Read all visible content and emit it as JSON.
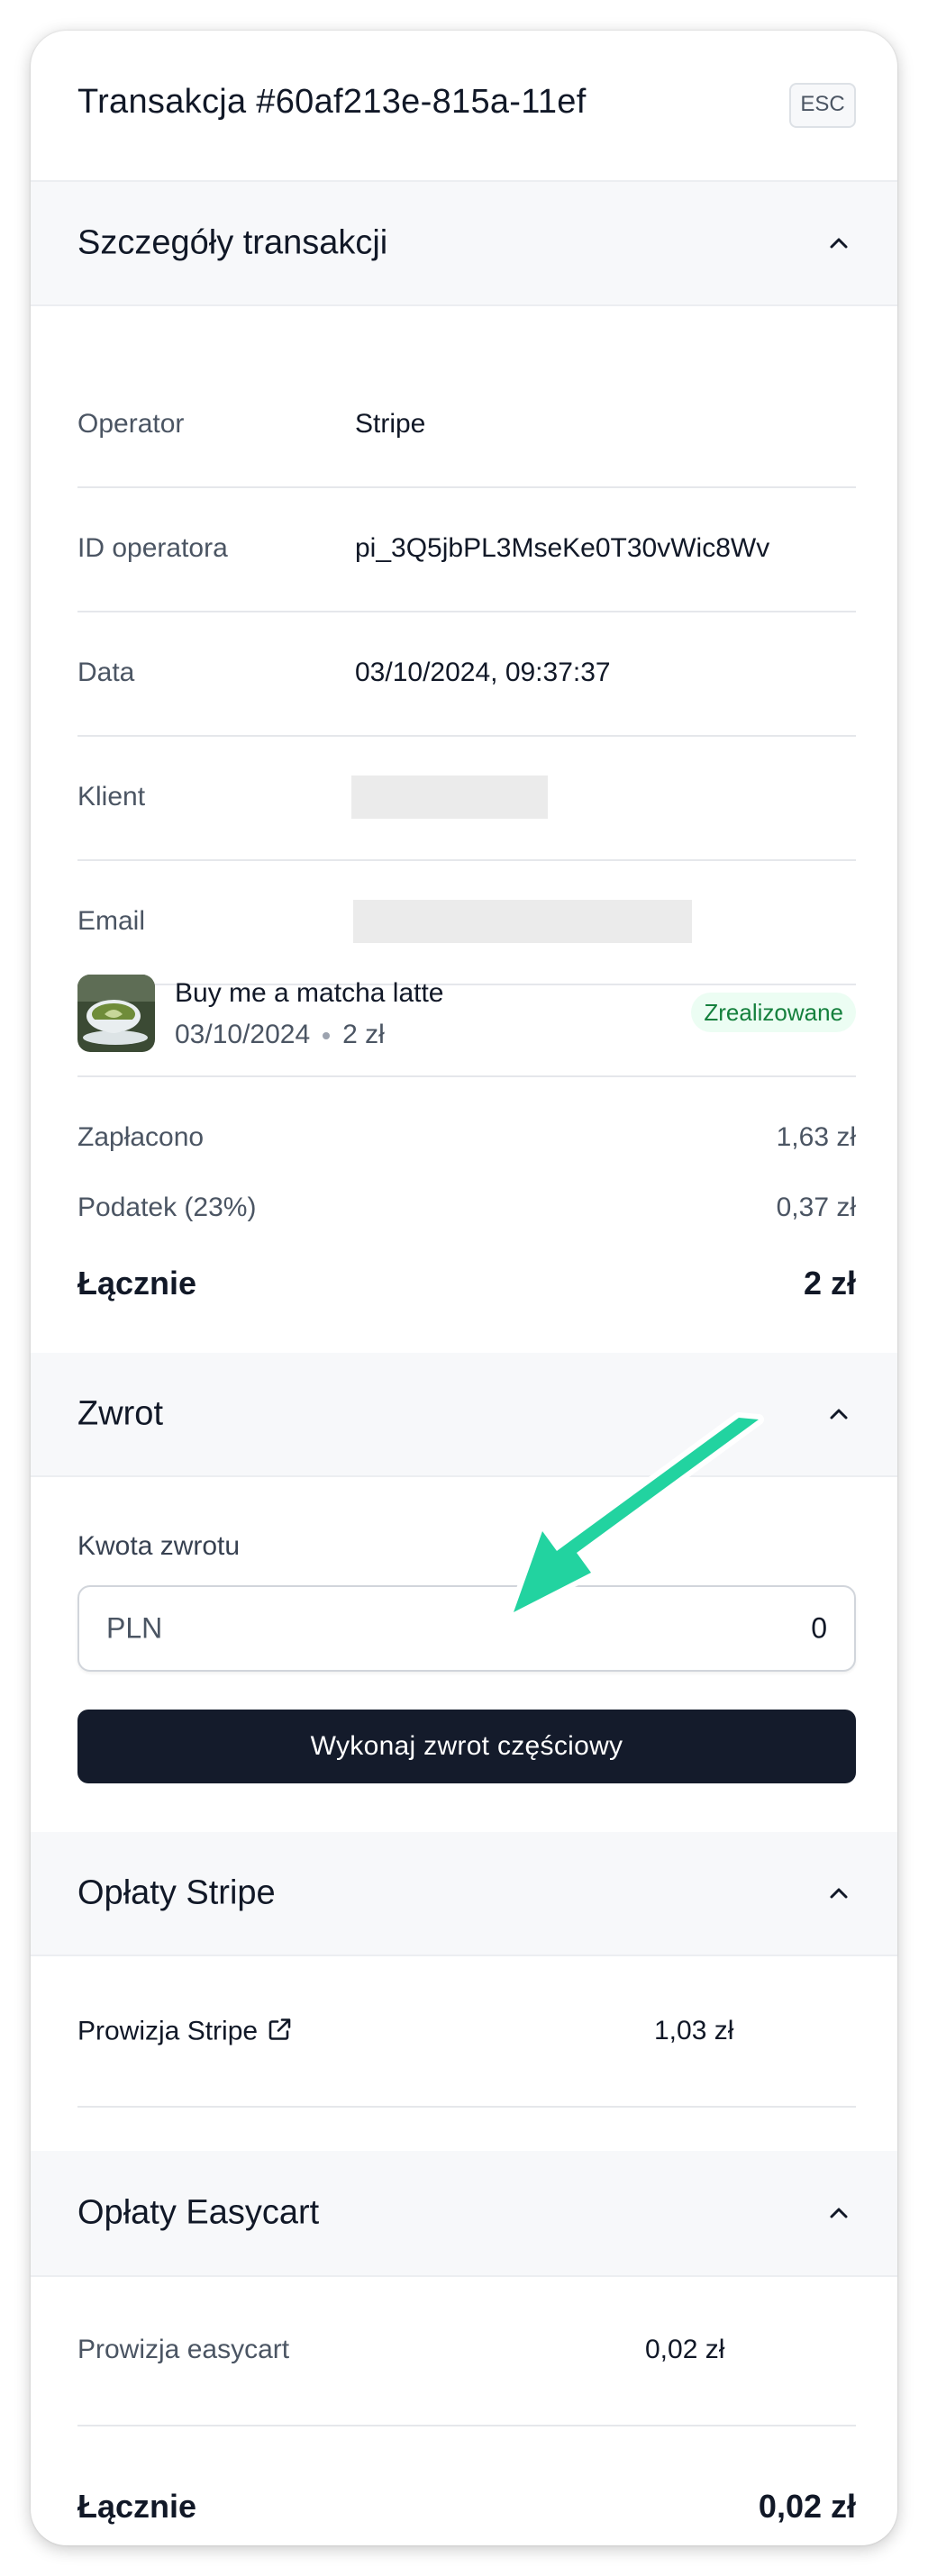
{
  "header": {
    "title": "Transakcja #60af213e-815a-11ef",
    "esc_label": "ESC"
  },
  "details": {
    "section_title": "Szczegóły transakcji",
    "rows": [
      {
        "label": "Operator",
        "value": "Stripe"
      },
      {
        "label": "ID operatora",
        "value": "pi_3Q5jbPL3MseKe0T30vWic8Wv"
      },
      {
        "label": "Data",
        "value": "03/10/2024, 09:37:37"
      },
      {
        "label": "Klient",
        "value": ""
      },
      {
        "label": "Email",
        "value": ""
      }
    ],
    "product": {
      "name": "Buy me a matcha latte",
      "date": "03/10/2024",
      "price": "2 zł",
      "status": "Zrealizowane"
    },
    "summary": {
      "paid_label": "Zapłacono",
      "paid_value": "1,63 zł",
      "tax_label": "Podatek (23%)",
      "tax_value": "0,37 zł",
      "total_label": "Łącznie",
      "total_value": "2 zł"
    }
  },
  "refund": {
    "section_title": "Zwrot",
    "amount_label": "Kwota zwrotu",
    "currency": "PLN",
    "amount_value": "0",
    "button_label": "Wykonaj zwrot częściowy"
  },
  "stripe_fees": {
    "section_title": "Opłaty Stripe",
    "fee_label": "Prowizja Stripe",
    "fee_value": "1,03 zł"
  },
  "easycart_fees": {
    "section_title": "Opłaty Easycart",
    "fee_label": "Prowizja easycart",
    "fee_value": "0,02 zł",
    "total_label": "Łącznie",
    "total_value": "0,02 zł"
  },
  "colors": {
    "button_bg": "#141b2b",
    "badge_bg": "#ecfdf3",
    "badge_text": "#15803d",
    "annotation_arrow": "#22d3a0"
  }
}
